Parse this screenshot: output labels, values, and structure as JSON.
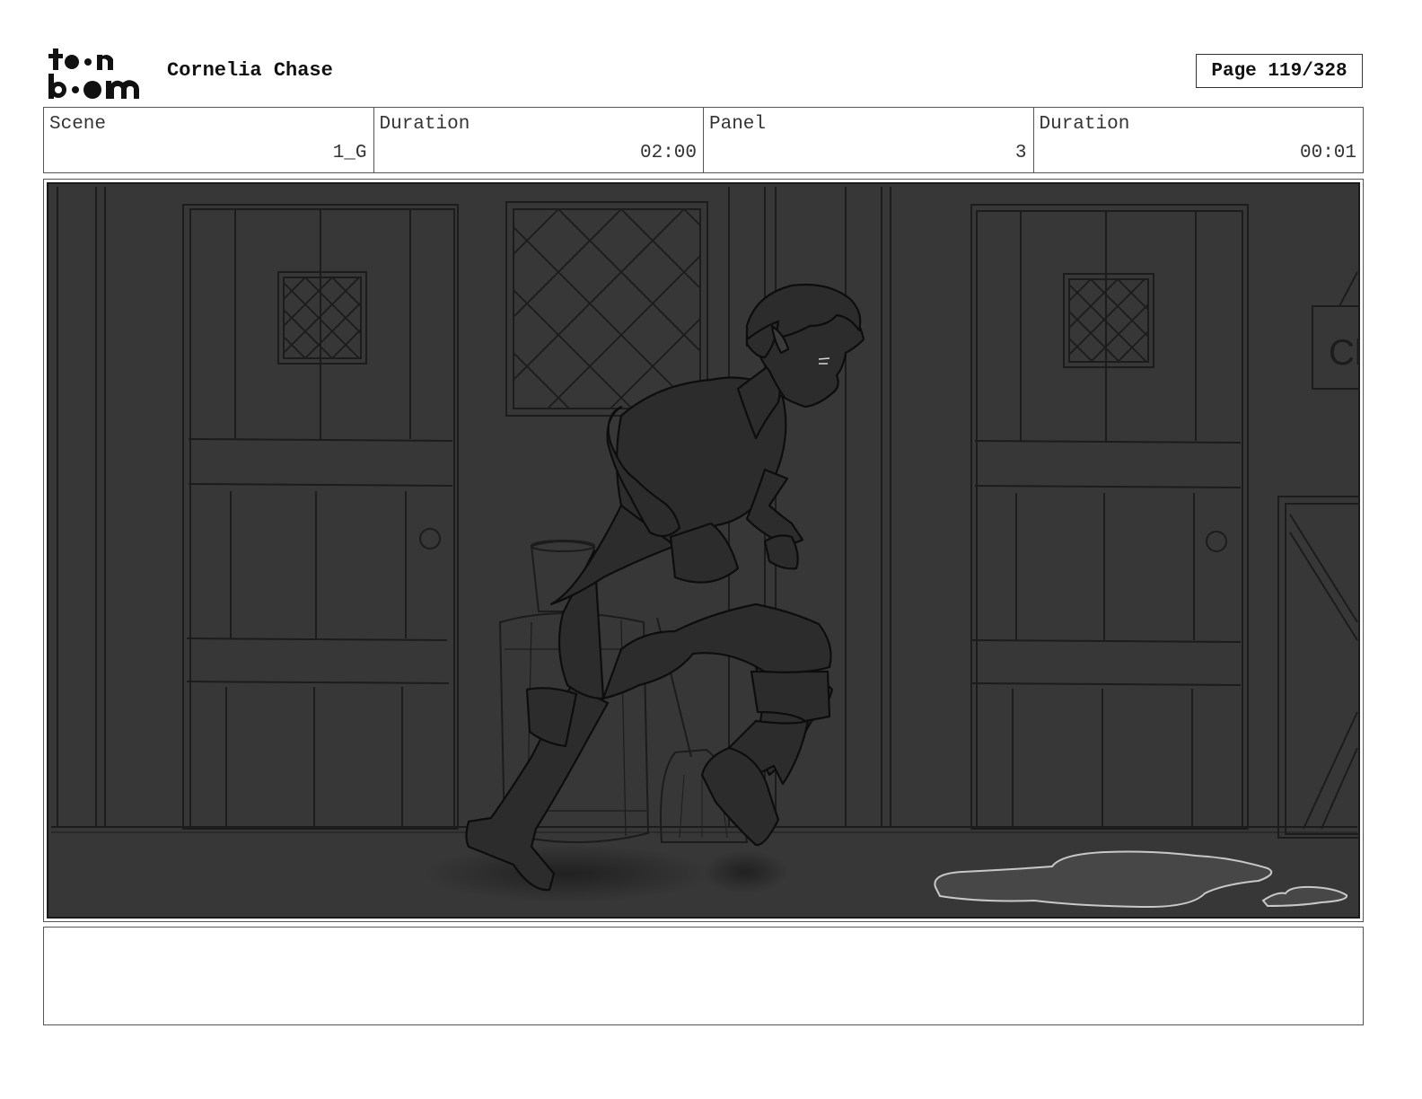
{
  "header": {
    "logo_text": "toon boom",
    "project_title": "Cornelia Chase",
    "page_label": "Page 119/328"
  },
  "info": {
    "scene_label": "Scene",
    "scene_value": "1_G",
    "scene_duration_label": "Duration",
    "scene_duration_value": "02:00",
    "panel_label": "Panel",
    "panel_value": "3",
    "panel_duration_label": "Duration",
    "panel_duration_value": "00:01"
  },
  "panel": {
    "sign_text": "Cl"
  },
  "notes": {
    "text": ""
  }
}
